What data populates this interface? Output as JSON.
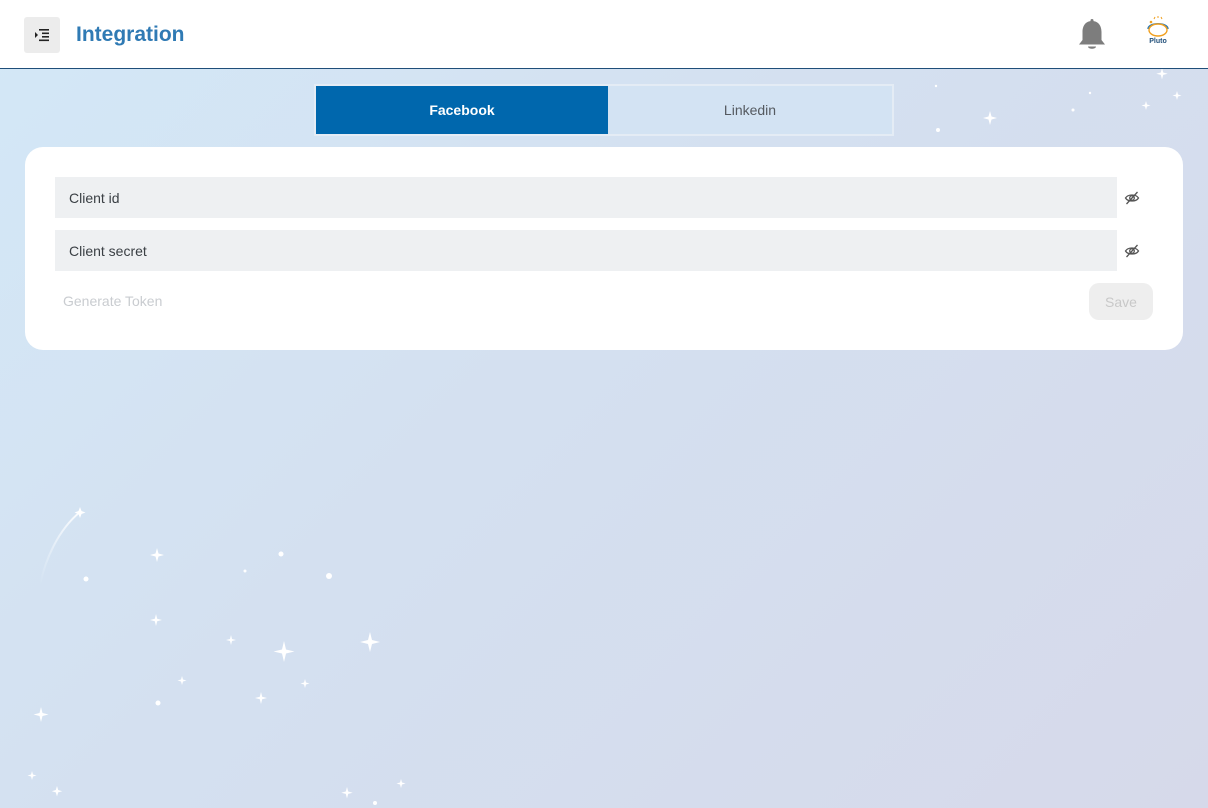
{
  "header": {
    "title": "Integration",
    "avatar_label": "Pluto",
    "icons": {
      "menu": "menu-indent-icon",
      "notifications": "bell-icon",
      "avatar": "pluto-logo-icon"
    }
  },
  "tabs": [
    {
      "label": "Facebook",
      "active": true
    },
    {
      "label": "Linkedin",
      "active": false
    }
  ],
  "form": {
    "client_id_placeholder": "Client id",
    "client_secret_placeholder": "Client secret",
    "generate_token_label": "Generate Token",
    "save_label": "Save",
    "visibility_icon": "eye-slash-icon"
  },
  "colors": {
    "accent": "#0067ad",
    "title": "#2f7ab4",
    "field_bg": "#eef0f2",
    "disabled_text": "#c9ccd0"
  }
}
